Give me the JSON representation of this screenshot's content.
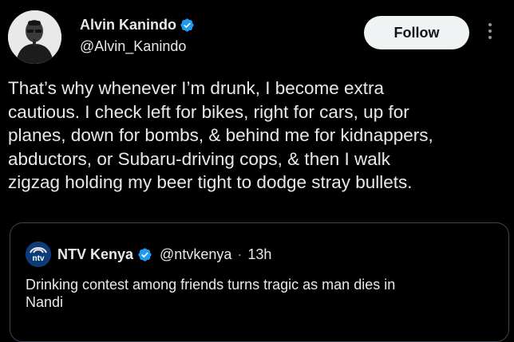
{
  "tweet": {
    "author": {
      "display_name": "Alvin Kanindo",
      "handle": "@Alvin_Kanindo",
      "verified_icon": "verified-badge-icon",
      "avatar_icon": "avatar-photo"
    },
    "follow_label": "Follow",
    "more_icon": "more-options-icon",
    "body_lines": [
      "That’s why whenever I’m drunk, I become extra",
      "cautious. I check left for bikes, right for cars, up for",
      "planes, down for bombs, & behind me for kidnappers,",
      "abductors, or Subaru-driving cops, & then I walk",
      "zigzag holding my beer tight to dodge stray bullets."
    ]
  },
  "quote": {
    "author": {
      "display_name": "NTV Kenya",
      "handle": "@ntvkenya",
      "time": "13h",
      "separator": "·",
      "logo_text": "ntv"
    },
    "text_lines": [
      "Drinking contest among friends turns tragic as man dies in",
      "Nandi"
    ]
  },
  "colors": {
    "background": "#000000",
    "text": "#e7e9ea",
    "verified": "#1d9bf0",
    "follow_bg": "#eff3f4",
    "border": "#3d4550"
  }
}
